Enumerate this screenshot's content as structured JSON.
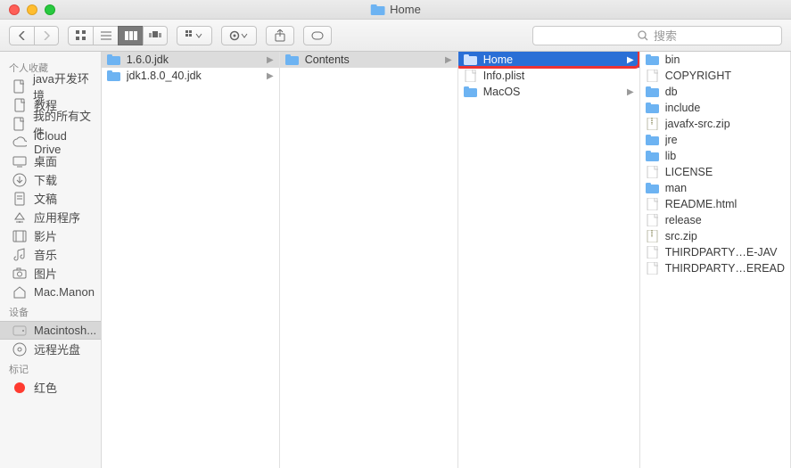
{
  "window": {
    "title": "Home"
  },
  "search": {
    "placeholder": "搜索"
  },
  "sidebar": {
    "sections": [
      {
        "header": "个人收藏",
        "items": [
          {
            "icon": "doc",
            "label": "java开发环境"
          },
          {
            "icon": "doc",
            "label": "教程"
          },
          {
            "icon": "doc",
            "label": "我的所有文件"
          },
          {
            "icon": "cloud",
            "label": "iCloud Drive"
          },
          {
            "icon": "desktop",
            "label": "桌面"
          },
          {
            "icon": "download",
            "label": "下载"
          },
          {
            "icon": "docs",
            "label": "文稿"
          },
          {
            "icon": "apps",
            "label": "应用程序"
          },
          {
            "icon": "movie",
            "label": "影片"
          },
          {
            "icon": "music",
            "label": "音乐"
          },
          {
            "icon": "camera",
            "label": "图片"
          },
          {
            "icon": "home",
            "label": "Mac.Manon"
          }
        ]
      },
      {
        "header": "设备",
        "items": [
          {
            "icon": "hdd",
            "label": "Macintosh...",
            "selected": true
          },
          {
            "icon": "disc",
            "label": "远程光盘"
          }
        ]
      },
      {
        "header": "标记",
        "items": [
          {
            "icon": "tag-red",
            "label": "红色"
          }
        ]
      }
    ]
  },
  "columns": [
    {
      "items": [
        {
          "type": "folder",
          "label": "1.6.0.jdk",
          "arrow": true,
          "sel": "gray"
        },
        {
          "type": "folder",
          "label": "jdk1.8.0_40.jdk",
          "arrow": true
        }
      ]
    },
    {
      "items": [
        {
          "type": "folder",
          "label": "Contents",
          "arrow": true,
          "sel": "gray"
        }
      ]
    },
    {
      "items": [
        {
          "type": "folder",
          "label": "Home",
          "arrow": true,
          "sel": "blue"
        },
        {
          "type": "file",
          "label": "Info.plist"
        },
        {
          "type": "folder",
          "label": "MacOS",
          "arrow": true
        }
      ],
      "highlight": true
    },
    {
      "items": [
        {
          "type": "folder",
          "label": "bin"
        },
        {
          "type": "file",
          "label": "COPYRIGHT"
        },
        {
          "type": "folder",
          "label": "db"
        },
        {
          "type": "folder",
          "label": "include"
        },
        {
          "type": "zip",
          "label": "javafx-src.zip"
        },
        {
          "type": "folder",
          "label": "jre"
        },
        {
          "type": "folder",
          "label": "lib"
        },
        {
          "type": "file",
          "label": "LICENSE"
        },
        {
          "type": "folder",
          "label": "man"
        },
        {
          "type": "file",
          "label": "README.html"
        },
        {
          "type": "file",
          "label": "release"
        },
        {
          "type": "zip",
          "label": "src.zip"
        },
        {
          "type": "file",
          "label": "THIRDPARTY…E-JAV"
        },
        {
          "type": "file",
          "label": "THIRDPARTY…EREAD"
        }
      ]
    }
  ],
  "colors": {
    "accent": "#2a6fd6",
    "highlight": "#e33",
    "folder": "#6db3f2"
  }
}
